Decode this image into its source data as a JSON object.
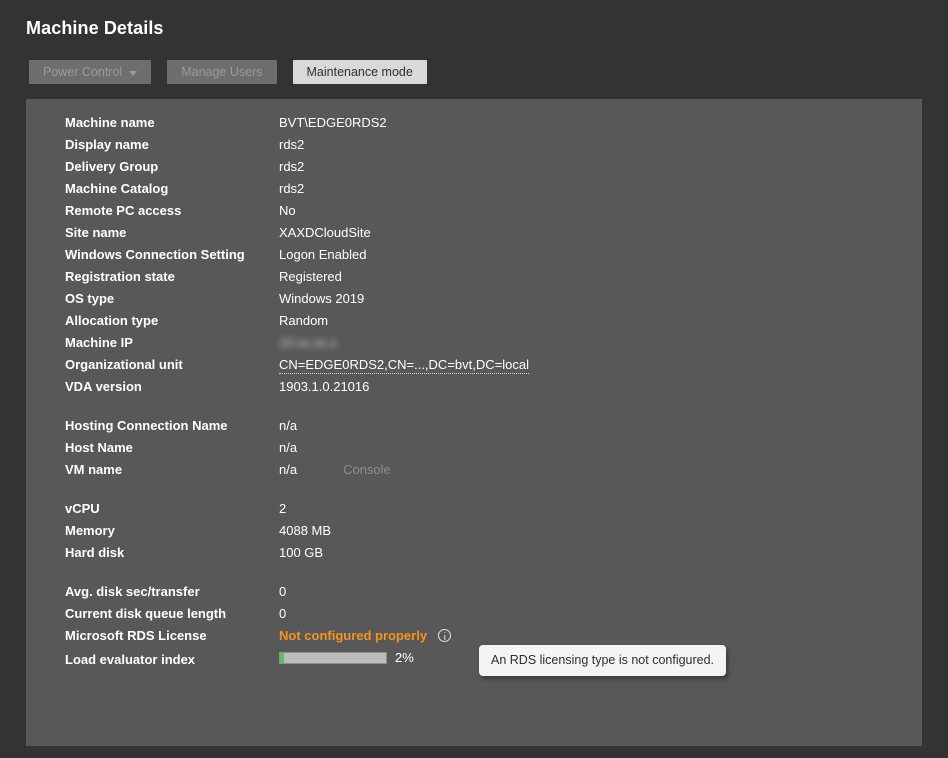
{
  "header": {
    "title": "Machine Details"
  },
  "toolbar": {
    "power_control_label": "Power Control",
    "manage_users_label": "Manage Users",
    "maintenance_mode_label": "Maintenance mode"
  },
  "details": {
    "groups": [
      {
        "rows": [
          {
            "label": "Machine name",
            "value": "BVT\\EDGE0RDS2"
          },
          {
            "label": "Display name",
            "value": "rds2"
          },
          {
            "label": "Delivery Group",
            "value": "rds2"
          },
          {
            "label": "Machine Catalog",
            "value": "rds2"
          },
          {
            "label": "Remote PC access",
            "value": "No"
          },
          {
            "label": "Site name",
            "value": "XAXDCloudSite"
          },
          {
            "label": "Windows Connection Setting",
            "value": "Logon Enabled"
          },
          {
            "label": "Registration state",
            "value": "Registered"
          },
          {
            "label": "OS type",
            "value": "Windows 2019"
          },
          {
            "label": "Allocation type",
            "value": "Random"
          },
          {
            "label": "Machine IP",
            "value": "10.xx.xx.x"
          },
          {
            "label": "Organizational unit",
            "value": "CN=EDGE0RDS2,CN=...,DC=bvt,DC=local"
          },
          {
            "label": "VDA version",
            "value": "1903.1.0.21016"
          }
        ]
      },
      {
        "rows": [
          {
            "label": "Hosting Connection Name",
            "value": "n/a"
          },
          {
            "label": "Host Name",
            "value": "n/a"
          },
          {
            "label": "VM name",
            "value": "n/a",
            "action": "Console"
          }
        ]
      },
      {
        "rows": [
          {
            "label": "vCPU",
            "value": "2"
          },
          {
            "label": "Memory",
            "value": "4088 MB"
          },
          {
            "label": "Hard disk",
            "value": "100 GB"
          }
        ]
      },
      {
        "rows": [
          {
            "label": "Avg. disk sec/transfer",
            "value": "0"
          },
          {
            "label": "Current disk queue length",
            "value": "0"
          },
          {
            "label": "Microsoft RDS License",
            "value": "Not configured properly"
          },
          {
            "label": "Load evaluator index",
            "value": "2%"
          }
        ]
      }
    ]
  },
  "load_evaluator": {
    "percent_label": "2%",
    "percent": 2,
    "fill_color": "#5fbf5f",
    "track_color": "#bdbdbd"
  },
  "rds_license": {
    "status_text": "Not configured properly",
    "status_color": "#f7941e",
    "info_icon": "info-circle-icon"
  },
  "tooltip": {
    "text": "An RDS licensing type is not configured."
  },
  "colors": {
    "page_background": "#333333",
    "panel_background": "#585858",
    "button_disabled": "#6e6e6e",
    "button_enabled": "#d9d9d9",
    "text_primary": "#ffffff",
    "text_muted": "#8d8d8d"
  }
}
